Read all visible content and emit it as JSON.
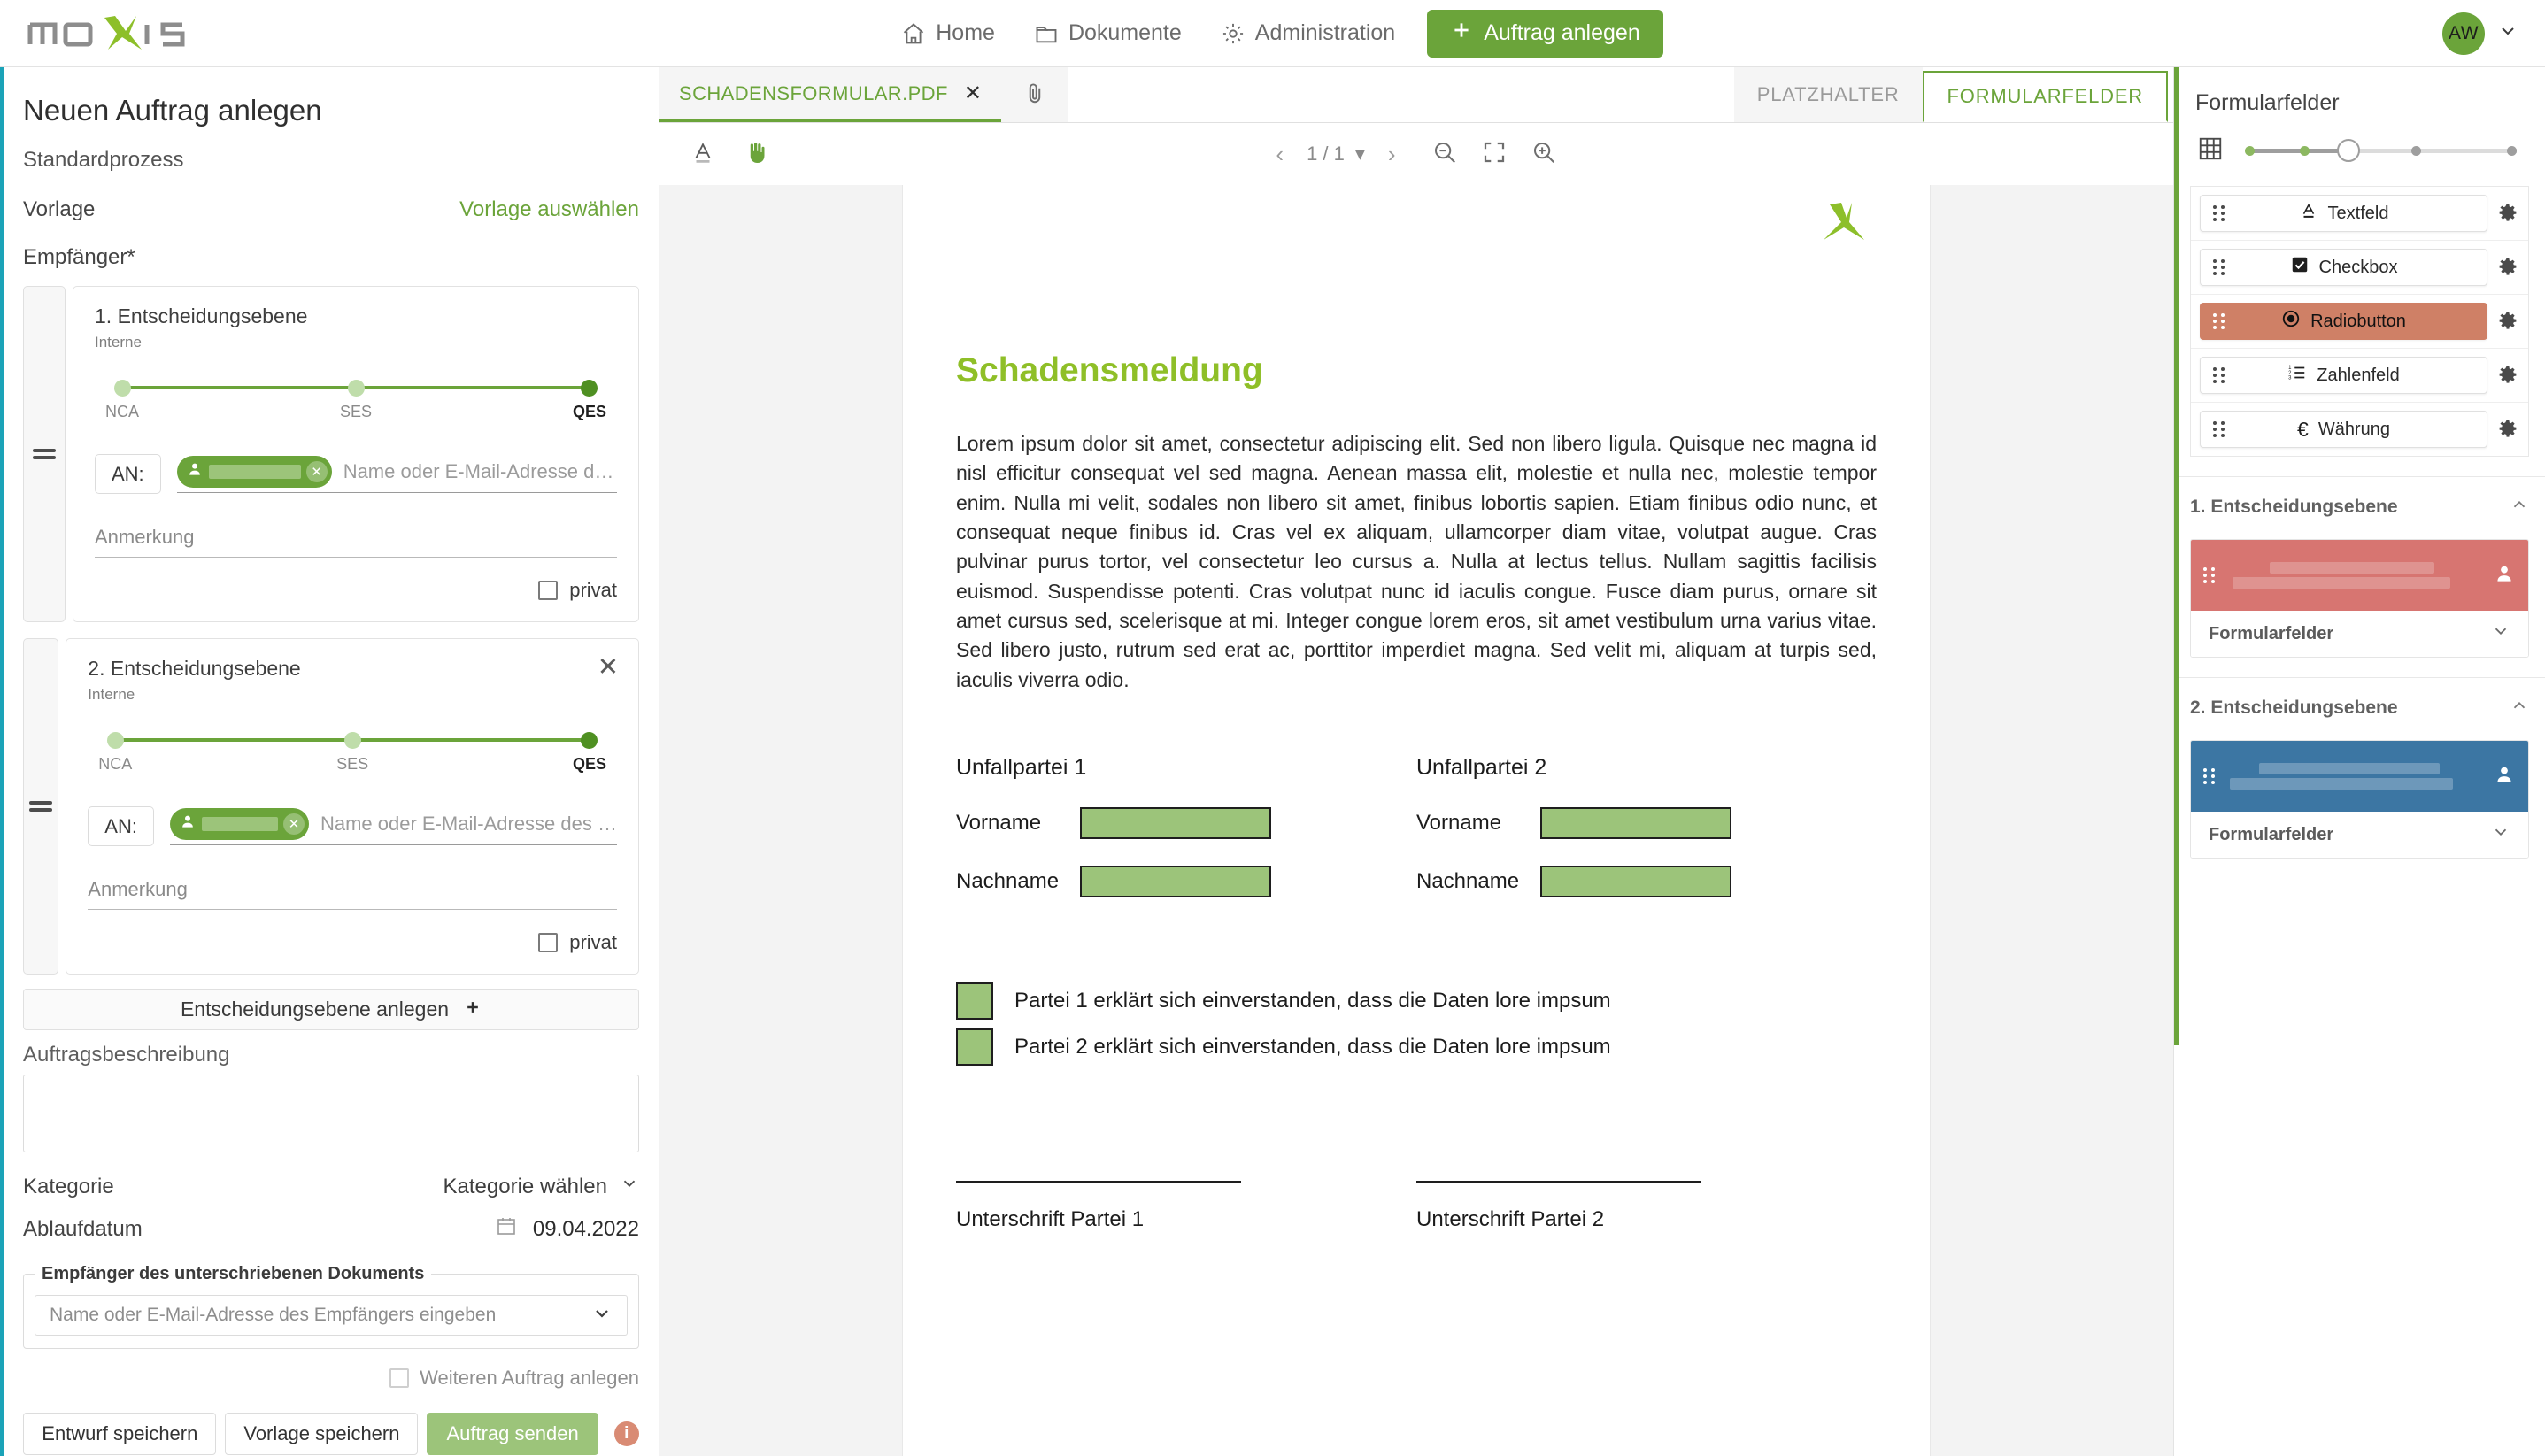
{
  "topbar": {
    "logo_text": "moxis",
    "nav": [
      {
        "id": "home",
        "label": "Home",
        "icon": "home-icon"
      },
      {
        "id": "dokumente",
        "label": "Dokumente",
        "icon": "folder-icon"
      },
      {
        "id": "administration",
        "label": "Administration",
        "icon": "gear-icon"
      }
    ],
    "primary_button": "Auftrag anlegen",
    "avatar_initials": "AW"
  },
  "left": {
    "title": "Neuen Auftrag anlegen",
    "process": "Standardprozess",
    "vorlage_label": "Vorlage",
    "vorlage_link": "Vorlage auswählen",
    "empfaenger_label": "Empfänger*",
    "levels": [
      {
        "title": "1. Entscheidungsebene",
        "subtitle": "Interne",
        "signature_levels": [
          "NCA",
          "SES",
          "QES"
        ],
        "selected_level": "QES",
        "an_label": "AN:",
        "recipient_chip": "",
        "recipient_placeholder": "Name oder E-Mail-Adresse d…",
        "anmerkung_label": "Anmerkung",
        "anmerkung_value": "",
        "privat_label": "privat",
        "privat_checked": false,
        "closable": false
      },
      {
        "title": "2. Entscheidungsebene",
        "subtitle": "Interne",
        "signature_levels": [
          "NCA",
          "SES",
          "QES"
        ],
        "selected_level": "QES",
        "an_label": "AN:",
        "recipient_chip": "",
        "recipient_placeholder": "Name oder E-Mail-Adresse des …",
        "anmerkung_label": "Anmerkung",
        "anmerkung_value": "",
        "privat_label": "privat",
        "privat_checked": false,
        "closable": true
      }
    ],
    "add_level_label": "Entscheidungsebene anlegen",
    "description_label": "Auftragsbeschreibung",
    "description_value": "",
    "kategorie_label": "Kategorie",
    "kategorie_value": "Kategorie wählen",
    "ablaufdatum_label": "Ablaufdatum",
    "ablaufdatum_value": "09.04.2022",
    "signed_doc_legend": "Empfänger des unterschriebenen Dokuments",
    "signed_doc_placeholder": "Name oder E-Mail-Adresse des Empfängers eingeben",
    "weiteren_label": "Weiteren Auftrag anlegen",
    "weiteren_checked": false,
    "buttons": {
      "draft": "Entwurf speichern",
      "template": "Vorlage speichern",
      "send": "Auftrag senden"
    }
  },
  "center": {
    "doc_tab_name": "SCHADENSFORMULAR.PDF",
    "right_tabs": [
      {
        "id": "platzhalter",
        "label": "PLATZHALTER",
        "active": false
      },
      {
        "id": "formularfelder",
        "label": "FORMULARFELDER",
        "active": true
      }
    ],
    "toolbar": {
      "text_tool": "text-tool-icon",
      "hand_tool": "hand-tool-icon",
      "page_indicator": "1 / 1",
      "zoom_out": "zoom-out-icon",
      "fit_page": "fit-page-icon",
      "zoom_in": "zoom-in-icon"
    },
    "document": {
      "heading": "Schadensmeldung",
      "paragraph": "Lorem ipsum dolor sit amet, consectetur adipiscing elit. Sed non libero ligula. Quisque nec magna id nisl efficitur consequat vel sed magna. Aenean massa elit, molestie et nulla nec, molestie tempor enim. Nulla mi velit, sodales non libero sit amet, finibus lobortis sapien. Etiam finibus odio nunc, et consequat neque finibus id. Cras vel ex aliquam, ullamcorper diam vitae, volutpat augue. Cras pulvinar purus tortor, vel consectetur leo cursus a. Nulla at lectus tellus. Nullam sagittis facilisis euismod. Suspendisse potenti. Cras volutpat nunc id iaculis congue. Fusce diam purus, ornare sit amet cursus sed, scelerisque at mi. Integer congue lorem eros, sit amet vestibulum urna varius vitae. Sed libero justo, rutrum sed erat ac, porttitor imperdiet magna. Sed velit mi, aliquam at turpis sed, iaculis viverra odio.",
      "parties": [
        {
          "title": "Unfallpartei 1",
          "vorname_label": "Vorname",
          "nachname_label": "Nachname"
        },
        {
          "title": "Unfallpartei 2",
          "vorname_label": "Vorname",
          "nachname_label": "Nachname"
        }
      ],
      "consents": [
        "Partei 1 erklärt sich einverstanden, dass die Daten lore impsum",
        "Partei 2 erklärt sich einverstanden, dass die Daten lore impsum"
      ],
      "signatures": [
        "Unterschrift Partei 1",
        "Unterschrift Partei 2"
      ]
    }
  },
  "right": {
    "title": "Formularfelder",
    "field_size_icon": "grid-icon",
    "size_slider": {
      "steps": 5,
      "value": 3
    },
    "palette": [
      {
        "id": "textfeld",
        "label": "Textfeld",
        "icon": "text-field-icon",
        "highlighted": false
      },
      {
        "id": "checkbox",
        "label": "Checkbox",
        "icon": "checkbox-icon",
        "highlighted": false
      },
      {
        "id": "radiobutton",
        "label": "Radiobutton",
        "icon": "radio-button-icon",
        "highlighted": true
      },
      {
        "id": "zahlenfeld",
        "label": "Zahlenfeld",
        "icon": "number-list-icon",
        "highlighted": false
      },
      {
        "id": "waehrung",
        "label": "Währung",
        "icon": "euro-icon",
        "highlighted": false
      }
    ],
    "sections": [
      {
        "id": "level1",
        "title": "1. Entscheidungsebene",
        "color": "#d77571",
        "recipient": "",
        "dropdown_label": "Formularfelder"
      },
      {
        "id": "level2",
        "title": "2. Entscheidungsebene",
        "color": "#3c76a3",
        "recipient": "",
        "dropdown_label": "Formularfelder"
      }
    ]
  },
  "colors": {
    "brand_green": "#6ba43a",
    "doc_heading_green": "#8fbf28",
    "field_green": "#9cc47a",
    "accent_teal": "#1ba3b8",
    "highlight_salmon": "#cf8066",
    "level1_red": "#d77571",
    "level2_blue": "#3c76a3"
  }
}
